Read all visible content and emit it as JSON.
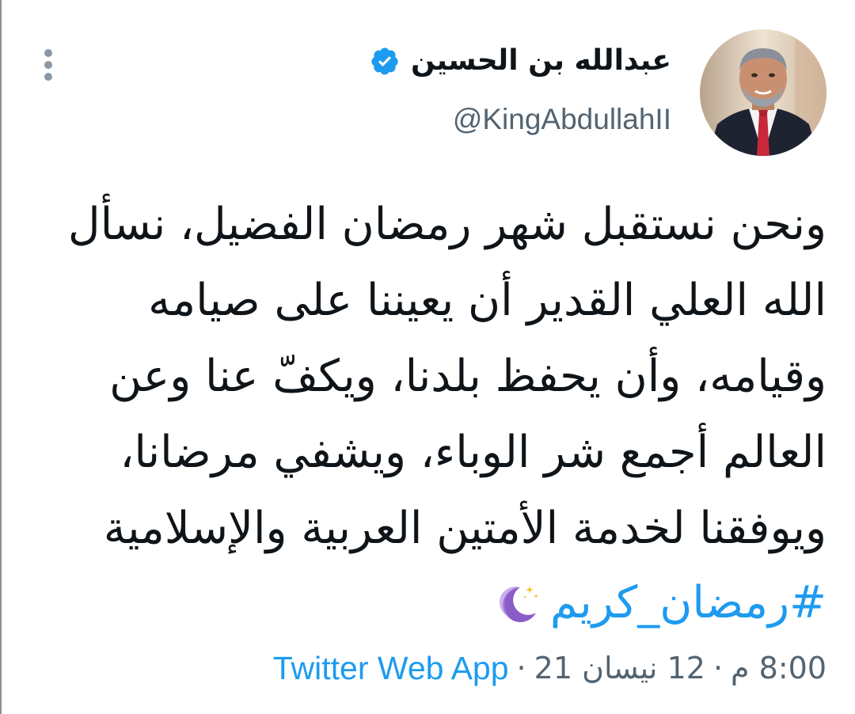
{
  "author": {
    "display_name": "عبدالله بن الحسين",
    "handle": "@KingAbdullahII",
    "verified_icon": "verified-badge-icon",
    "avatar_icon": "avatar"
  },
  "tweet": {
    "lines": [
      "ونحن نستقبل شهر رمضان الفضيل، نسأل",
      "الله العلي القدير أن يعيننا على صيامه",
      "وقيامه، وأن يحفظ بلدنا، ويكفّ عنا وعن",
      "العالم أجمع شر الوباء، ويشفي مرضانا،",
      "ويوفقنا لخدمة الأمتين العربية والإسلامية"
    ],
    "hashtag": "#رمضان_كريم",
    "emoji_icon": "crescent-moon-icon"
  },
  "meta": {
    "time": "8:00 م",
    "separator": "·",
    "date": "12 نيسان 21",
    "source": "Twitter Web App"
  },
  "colors": {
    "accent": "#1d9bf0",
    "secondary_text": "#536471",
    "primary_text": "#0f1419"
  }
}
